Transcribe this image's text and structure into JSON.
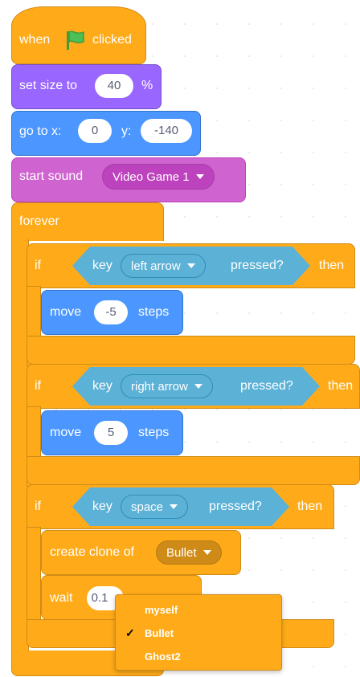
{
  "script": {
    "hat": {
      "label_when": "when",
      "label_clicked": "clicked",
      "flag_icon": "green-flag-icon"
    },
    "set_size": {
      "label": "set size to",
      "value": "40",
      "unit": "%"
    },
    "go_to": {
      "label": "go to x:",
      "x_value": "0",
      "y_label": "y:",
      "y_value": "-140"
    },
    "start_sound": {
      "label": "start sound",
      "sound": "Video Game 1"
    },
    "forever": {
      "label": "forever"
    },
    "if_left": {
      "if_label": "if",
      "key_label": "key",
      "key": "left arrow",
      "pressed_label": "pressed?",
      "then_label": "then"
    },
    "move_left": {
      "label": "move",
      "value": "-5",
      "steps_label": "steps"
    },
    "if_right": {
      "if_label": "if",
      "key_label": "key",
      "key": "right arrow",
      "pressed_label": "pressed?",
      "then_label": "then"
    },
    "move_right": {
      "label": "move",
      "value": "5",
      "steps_label": "steps"
    },
    "if_space": {
      "if_label": "if",
      "key_label": "key",
      "key": "space",
      "pressed_label": "pressed?",
      "then_label": "then"
    },
    "create_clone": {
      "label": "create clone of",
      "target": "Bullet"
    },
    "wait": {
      "label": "wait",
      "value": "0.1"
    }
  },
  "dropdown_menu": {
    "items": [
      "myself",
      "Bullet",
      "Ghost2"
    ],
    "selected": "Bullet"
  },
  "colors": {
    "events": "#ffab19",
    "looks": "#9966ff",
    "motion": "#4c97ff",
    "sound": "#cf63cf",
    "sensing": "#5cb1d6",
    "control": "#ffab19"
  }
}
